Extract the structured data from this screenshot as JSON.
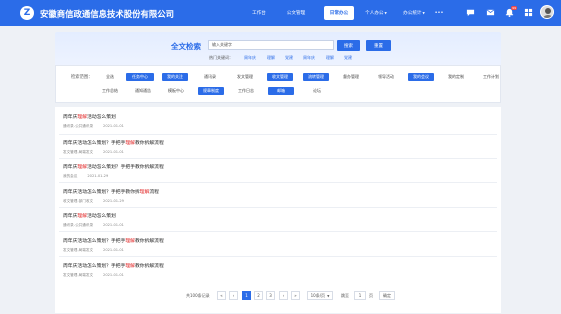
{
  "header": {
    "company": "安徽商信政通信息技术股份有限公司",
    "nav": [
      {
        "label": "工作台"
      },
      {
        "label": "公文管理"
      },
      {
        "label": "日常办公",
        "active": true
      },
      {
        "label": "个人办公"
      },
      {
        "label": "办公统计"
      },
      {
        "label": "•••"
      }
    ],
    "icons": [
      "chat-icon",
      "mail-icon",
      "bell-icon",
      "grid-icon"
    ],
    "bell_badge": "99"
  },
  "search": {
    "title": "全文检索",
    "input_value": "输入关键字",
    "search_label": "搜索",
    "reset_label": "重置",
    "hot_label": "热门关键词：",
    "hot_keywords": [
      "周年庆",
      "理解",
      "党建",
      "周年庆",
      "理解",
      "党建"
    ]
  },
  "filter": {
    "label": "检索范围：",
    "row1": [
      {
        "label": "全选",
        "on": false
      },
      {
        "label": "任务中心",
        "on": true
      },
      {
        "label": "我的关注",
        "on": true
      },
      {
        "label": "通讯录",
        "on": false
      },
      {
        "label": "发文管理",
        "on": false
      },
      {
        "label": "收文管理",
        "on": true
      },
      {
        "label": "流转管理",
        "on": true
      },
      {
        "label": "督办管理",
        "on": false
      },
      {
        "label": "领导活动",
        "on": false
      },
      {
        "label": "我的会议",
        "on": true
      },
      {
        "label": "我的定制",
        "on": false
      },
      {
        "label": "工作计划",
        "on": false
      }
    ],
    "row2": [
      {
        "label": "工作总结",
        "on": false
      },
      {
        "label": "通知通告",
        "on": false
      },
      {
        "label": "模板中心",
        "on": false
      },
      {
        "label": "规章制度",
        "on": true
      },
      {
        "label": "工作日志",
        "on": false
      },
      {
        "label": "邮箱",
        "on": true
      },
      {
        "label": "论坛",
        "on": false
      }
    ]
  },
  "results": [
    {
      "pre": "周年庆",
      "hl": "理解",
      "post": "活动怎么策划",
      "source": "通讯录-公共通讯录",
      "date": "2021-01-01"
    },
    {
      "pre": "周年庆活动怎么策划？手把手",
      "hl": "理解",
      "post": "教你拆解流程",
      "source": "发文管理-局端发文",
      "date": "2021-01-01"
    },
    {
      "pre": "周年庆",
      "hl": "理解",
      "post": "活动怎么策划？手把手教你拆解流程",
      "source": "我的会议",
      "date": "2021-01-29"
    },
    {
      "pre": "周年庆活动怎么策划？手把手教你拆",
      "hl": "理解",
      "post": "流程",
      "source": "收文管理-部门收文",
      "date": "2021-01-29"
    },
    {
      "pre": "周年庆",
      "hl": "理解",
      "post": "活动怎么策划",
      "source": "通讯录-公共通讯录",
      "date": "2021-01-01"
    },
    {
      "pre": "周年庆活动怎么策划？手把手",
      "hl": "理解",
      "post": "教你拆解流程",
      "source": "发文管理-局端发文",
      "date": "2021-01-01"
    },
    {
      "pre": "周年庆活动怎么策划？手把手",
      "hl": "理解",
      "post": "教你拆解流程",
      "source": "发文管理-局端发文",
      "date": "2021-01-01"
    }
  ],
  "pager": {
    "total": "共100条记录",
    "pages": [
      "1",
      "2",
      "3"
    ],
    "current": "1",
    "page_size": "10条/页",
    "goto_label": "跳至",
    "goto_value": "1",
    "page_unit": "页",
    "confirm": "确定"
  }
}
